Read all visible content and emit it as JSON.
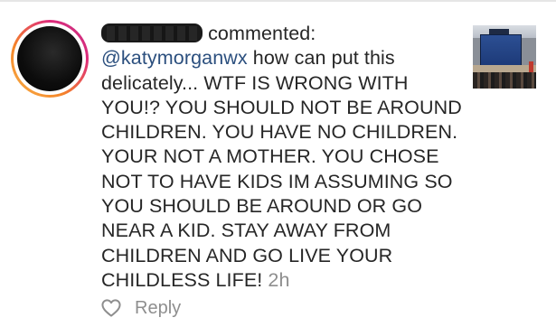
{
  "comment": {
    "action": "commented:",
    "mention": "@katymorganwx",
    "body": " how can put this delicately... WTF IS WRONG WITH YOU!? YOU SHOULD NOT BE AROUND CHILDREN. YOU HAVE NO CHILDREN. YOUR NOT A MOTHER. YOU CHOSE NOT TO HAVE KIDS IM ASSUMING SO YOU SHOULD BE AROUND OR GO NEAR A KID. STAY AWAY FROM CHILDREN AND GO LIVE YOUR CHILDLESS LIFE!",
    "timestamp": "2h"
  },
  "actions": {
    "like_icon": "heart-outline-icon",
    "reply_label": "Reply"
  },
  "colors": {
    "mention": "#2b4f7e",
    "text": "#262626",
    "muted": "#8e8e8e",
    "ring_gradient": [
      "#f7b24a",
      "#dd2a7b",
      "#c13584"
    ]
  }
}
